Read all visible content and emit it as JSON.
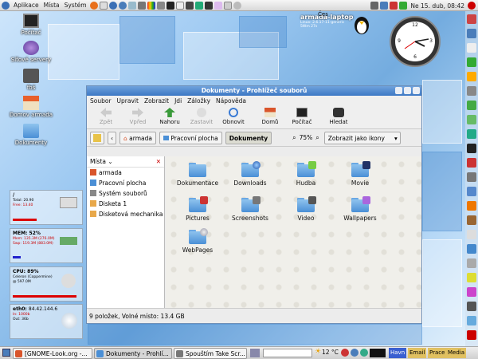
{
  "top_panel": {
    "menus": [
      "Aplikace",
      "Místa",
      "Systém"
    ],
    "clock": "Ne 15. dub, 08:42",
    "lang": "Čes"
  },
  "host": {
    "name": "armada-laptop",
    "line1": "Linux: 2.6.17-11-generic",
    "line2": "5Wm 27s"
  },
  "desktop_icons": [
    "Počítač",
    "Síťové servery",
    "fbš",
    "Domov armada",
    "Dokumenty"
  ],
  "monitors": {
    "disk": {
      "title": "/",
      "l1": "Total: 20.90",
      "l2": "Free: 13.40"
    },
    "mem": {
      "title": "MEM:",
      "pct": "52%",
      "l1": "Mem: 135.3M (276.0M)",
      "l2": "Swp: 119.3M (883.0M)"
    },
    "cpu": {
      "title": "CPU:",
      "pct": "89%",
      "l1": "Celeron (Coppermine)",
      "l2": "@ 597.0M"
    },
    "net": {
      "title": "eth0:",
      "ip": "84.42.144.6",
      "l1": "In: 1000b",
      "l2": "Out: 36b"
    }
  },
  "window": {
    "title": "Dokumenty - Prohlížeč souborů",
    "menu": [
      "Soubor",
      "Upravit",
      "Zobrazit",
      "Jdi",
      "Záložky",
      "Nápověda"
    ],
    "toolbar": {
      "back": "Zpět",
      "forward": "Vpřed",
      "up": "Nahoru",
      "stop": "Zastavit",
      "reload": "Obnovit",
      "home": "Domů",
      "computer": "Počítač",
      "search": "Hledat"
    },
    "path": [
      "armada",
      "Pracovní plocha",
      "Dokumenty"
    ],
    "zoom": "75%",
    "view_mode": "Zobrazit jako ikony",
    "sidebar_title": "Místa",
    "places": [
      "armada",
      "Pracovní plocha",
      "Systém souborů",
      "Disketa 1",
      "Disketová mechanika"
    ],
    "files": [
      "Dokumentace",
      "Downloads",
      "Hudba",
      "Movie",
      "Pictures",
      "Screenshots",
      "Video",
      "Wallpapers",
      "WebPages"
    ],
    "status": "9 položek, Volné místo: 13.4 GB"
  },
  "taskbar": {
    "tasks": [
      "[GNOME-Look.org -...",
      "Dokumenty - Prohlí...",
      "Spouštím Take Scr..."
    ],
    "weather": "12 °C",
    "tray": [
      "Email",
      "Prace",
      "Media"
    ],
    "tray_first": "Havn"
  },
  "colors": {
    "accent": "#3d78c4",
    "folder": "#4a8fd6"
  }
}
